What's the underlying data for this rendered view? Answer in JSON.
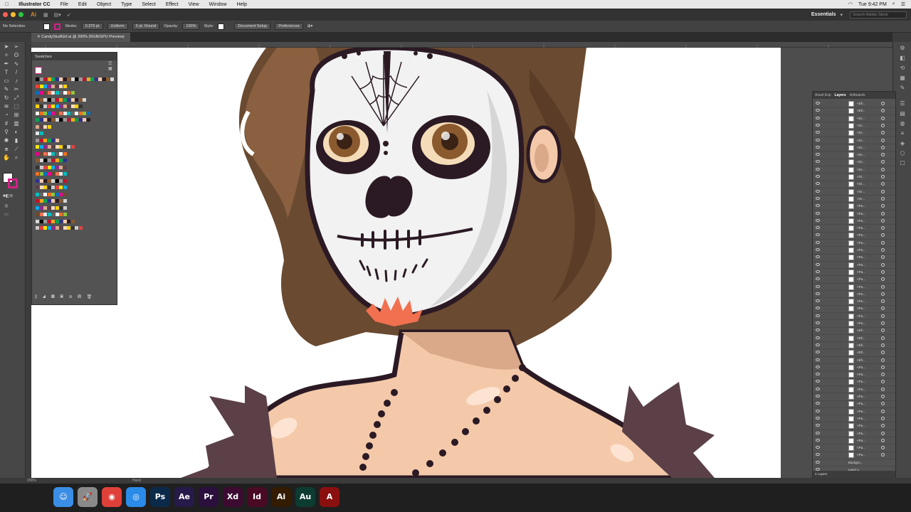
{
  "menubar": {
    "app_name": "Illustrator CC",
    "items": [
      "File",
      "Edit",
      "Object",
      "Type",
      "Select",
      "Effect",
      "View",
      "Window",
      "Help"
    ],
    "clock": "Tue 9:42 PM"
  },
  "approw": {
    "workspace": "Essentials",
    "search_placeholder": "Search Adobe Stock"
  },
  "control_bar": {
    "selection": "No Selection",
    "stroke_label": "Stroke:",
    "stroke_value": "0.375 pt",
    "stroke_profile": "Uniform",
    "brush": "5 pt. Round",
    "opacity_label": "Opacity:",
    "opacity_value": "100%",
    "style_label": "Style:",
    "document_setup": "Document Setup",
    "preferences": "Preferences"
  },
  "document": {
    "tab_title": "CandySkullGirl.ai @ 200% (RGB/GPU Preview)"
  },
  "swatches_panel": {
    "title": "Swatches"
  },
  "layers_panel": {
    "tabs": [
      "Asset Exp",
      "Layers",
      "Artboards"
    ],
    "active_tab": "Layers",
    "rows": [
      "<Ell...",
      "<Ell...",
      "<Gr...",
      "<Gr...",
      "<Gr...",
      "<Gr...",
      "<Gr...",
      "<Gr...",
      "<Gr...",
      "<Gr...",
      "<Gr...",
      "<Gr...",
      "<Gr...",
      "<Gr...",
      "<Pa...",
      "<Pa...",
      "<Pa...",
      "<Pa...",
      "<Pa...",
      "<Pa...",
      "<Pa...",
      "<Pa...",
      "<Pa...",
      "<Pa...",
      "<Pa...",
      "<Pa...",
      "<Pa...",
      "<Pa...",
      "<Pa...",
      "<Pa...",
      "<Pa...",
      "<Ell...",
      "<Ell...",
      "<Ell...",
      "<Ell...",
      "<Ell...",
      "<Pa...",
      "<Pa...",
      "<Pa...",
      "<Pa...",
      "<Pa...",
      "<Pa...",
      "<Pa...",
      "<Pa...",
      "<Pa...",
      "<Pa...",
      "<Pa...",
      "<Pa...",
      "<Pa..."
    ],
    "bottom_layers": [
      "Backgro...",
      "Layer 1"
    ],
    "layer_count": "4 Layers"
  },
  "statusbar": {
    "zoom": "200%",
    "tool": "Hand"
  },
  "dock": {
    "apps": [
      {
        "name": "Finder",
        "glyph": "☺",
        "color": "#3a8ee6"
      },
      {
        "name": "Launchpad",
        "glyph": "🚀",
        "color": "#8a8a8a"
      },
      {
        "name": "Chrome",
        "glyph": "◉",
        "color": "#e0403a"
      },
      {
        "name": "Safari",
        "glyph": "◎",
        "color": "#2a8be8"
      },
      {
        "name": "Photoshop",
        "glyph": "Ps",
        "color": "#0b2a4a"
      },
      {
        "name": "After Effects",
        "glyph": "Ae",
        "color": "#261a4a"
      },
      {
        "name": "Premiere",
        "glyph": "Pr",
        "color": "#2b0f3d"
      },
      {
        "name": "XD",
        "glyph": "Xd",
        "color": "#3d0a31"
      },
      {
        "name": "InDesign",
        "glyph": "Id",
        "color": "#4a0a25"
      },
      {
        "name": "Illustrator",
        "glyph": "Ai",
        "color": "#331c00"
      },
      {
        "name": "Audition",
        "glyph": "Au",
        "color": "#0c3b32"
      },
      {
        "name": "Acrobat",
        "glyph": "A",
        "color": "#8a0f0f"
      }
    ]
  }
}
